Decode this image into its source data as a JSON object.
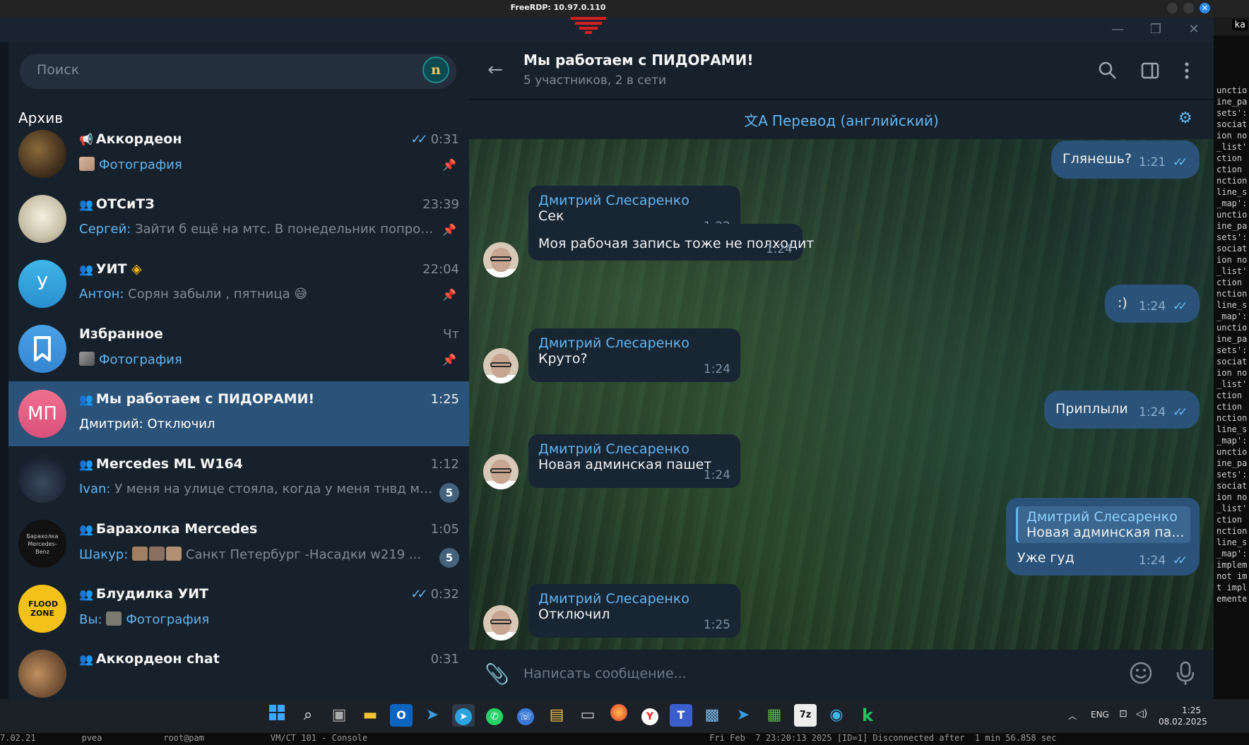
{
  "rdp": {
    "title": "FreeRDP: 10.97.0.110"
  },
  "window": {
    "minimize_icon": "minimize-icon",
    "restore_icon": "restore-icon",
    "close_icon": "close-icon"
  },
  "search": {
    "placeholder": "Поиск",
    "badge": "n"
  },
  "sidebar": {
    "archive_label": "Архив",
    "chats": [
      {
        "name": "Аккордеон",
        "time": "0:31",
        "sender": "",
        "preview": "Фотография",
        "read": true,
        "pinned": true,
        "unread": ""
      },
      {
        "name": "ОТСиТЗ",
        "time": "23:39",
        "sender": "Сергей:",
        "preview": "Зайти б ещё на мтс. В понедельник попроб...",
        "pinned": true,
        "unread": ""
      },
      {
        "name": "УИТ",
        "time": "22:04",
        "sender": "Антон:",
        "preview": "Сорян забыли , пятница 😅",
        "pinned": true,
        "unread": "",
        "avatar_letter": "У"
      },
      {
        "name": "Избранное",
        "time": "Чт",
        "sender": "",
        "preview": "Фотография",
        "pinned": true,
        "unread": ""
      },
      {
        "name": "Мы работаем с ПИДОРАМИ!",
        "time": "1:25",
        "sender": "Дмитрий:",
        "preview": "Отключил",
        "active": true,
        "unread": "",
        "avatar_letter": "МП"
      },
      {
        "name": "Mercedes ML W164",
        "time": "1:12",
        "sender": "Ivan:",
        "preview": "У меня на улице стояла, когда у меня тнвд ме...",
        "unread": "5"
      },
      {
        "name": "Барахолка Mercedes",
        "time": "1:05",
        "sender": "Шакур:",
        "preview": "Санкт Петербург   -Насадки w219   ...",
        "unread": "5",
        "avatar_text": "Барахолка Mercedes-Benz"
      },
      {
        "name": "Блудилка УИТ",
        "time": "0:32",
        "sender": "Вы:",
        "preview": "Фотография",
        "read": true,
        "unread": "",
        "avatar_text": "FLOOD ZONE"
      },
      {
        "name": "Аккордеон chat",
        "time": "0:31",
        "sender": "",
        "preview": "",
        "unread": ""
      }
    ]
  },
  "chat": {
    "title": "Мы работаем с ПИДОРАМИ!",
    "subtitle": "5 участников, 2 в сети",
    "translate_label": "Перевод (английский)",
    "composer_placeholder": "Написать сообщение...",
    "messages": [
      {
        "out": true,
        "text": "Глянешь?",
        "time": "1:21"
      },
      {
        "out": false,
        "author": "Дмитрий Слесаренко",
        "text": "Сек",
        "time": "1:22"
      },
      {
        "out": false,
        "author": "",
        "text": "Моя рабочая запись тоже не полходит",
        "time": "1:24"
      },
      {
        "out": true,
        "text": ":)",
        "time": "1:24"
      },
      {
        "out": false,
        "author": "Дмитрий Слесаренко",
        "text": "Круто?",
        "time": "1:24"
      },
      {
        "out": true,
        "text": "Приплыли",
        "time": "1:24"
      },
      {
        "out": false,
        "author": "Дмитрий Слесаренко",
        "text": "Новая админская пашет",
        "time": "1:24"
      },
      {
        "out": true,
        "reply_author": "Дмитрий Слесаренко",
        "reply_text": "Новая админская па...",
        "text": "Уже гуд",
        "time": "1:24"
      },
      {
        "out": false,
        "author": "Дмитрий Слесаренко",
        "text": "Отключил",
        "time": "1:25"
      }
    ]
  },
  "taskbar": {
    "lang": "ENG",
    "time": "1:25",
    "date": "08.02.2025",
    "bottom_text": "7.02.21         pvea            root@pam             VM/CT 101 - Console                                                                   Fri Feb  7 23:20:13 2025 [ID=1] Disconnected after  1 min 56.858 sec"
  },
  "console": {
    "lines": [
      "unctio",
      "ine_pa",
      "sets':",
      "sociat",
      "ion no",
      "_list'",
      "ction",
      "ction",
      "nction",
      "line_s",
      "_map':",
      "unctio",
      "ine_pa",
      "sets':",
      "sociat",
      "ion no",
      "_list'",
      "ction",
      "nction",
      "line_s",
      "_map':",
      "unctio",
      "ine_pa",
      "sets':",
      "sociat",
      "ion no",
      "_list'",
      "ction",
      "ction",
      "nction",
      "line_s",
      "_map':",
      "unctio",
      "ine_pa",
      "sets':",
      "sociat",
      "ion no",
      "_list'",
      "ction",
      "nction",
      "line_s",
      "_map':",
      "implem",
      "not im",
      "t impl",
      "emente"
    ],
    "tab": "ka"
  }
}
